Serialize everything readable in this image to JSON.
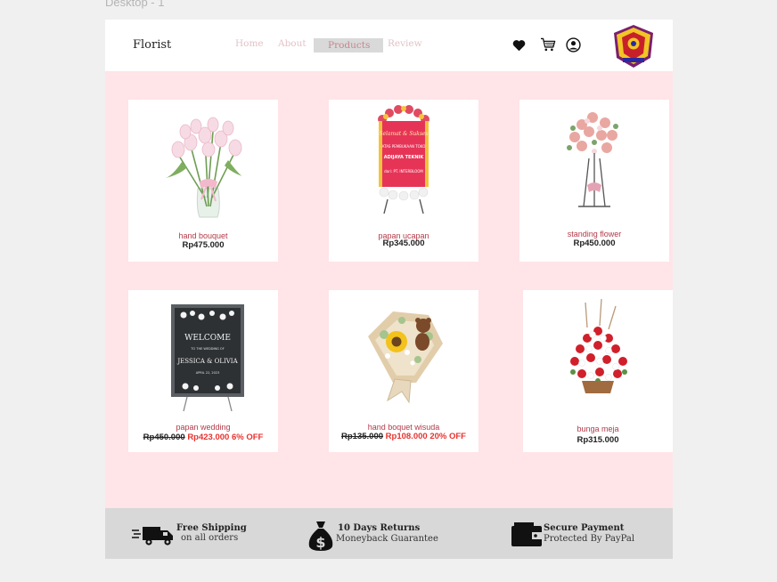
{
  "canvas": {
    "frame_label": "Desktop - 1"
  },
  "header": {
    "brand": "Florist",
    "nav": [
      "Home",
      "About",
      "Products",
      "Review"
    ],
    "active_nav": "Products",
    "icons": [
      "heart-icon",
      "cart-icon",
      "user-icon"
    ]
  },
  "products": [
    {
      "name": "hand bouquet",
      "price": "Rp475.000"
    },
    {
      "name": "papan ucapan",
      "price": "Rp345.000",
      "sign_lines": [
        "Selamat & Sukses",
        "ATAS PEMBUKAAN TOKO",
        "ADIJAYA TEKNIK",
        "dari: PT. INTERBLOOM"
      ]
    },
    {
      "name": "standing flower",
      "price": "Rp450.000"
    },
    {
      "name": "papan wedding",
      "old_price": "Rp450.000",
      "new_price": "Rp423.000 6% OFF",
      "sign_lines": [
        "WELCOME",
        "TO THE WEDDING OF",
        "JESSICA & OLIVIA",
        "APRIL 22, 2023"
      ]
    },
    {
      "name": "hand boquet wisuda",
      "old_price": "Rp135.000",
      "new_price": "Rp108.000 20% OFF"
    },
    {
      "name": "bunga meja",
      "price": "Rp315.000"
    }
  ],
  "footer": {
    "features": [
      {
        "title": "Free Shipping",
        "subtitle": "on all orders",
        "icon": "truck-icon"
      },
      {
        "title": "10 Days Returns",
        "subtitle": "Moneyback Guarantee",
        "icon": "money-bag-icon"
      },
      {
        "title": "Secure Payment",
        "subtitle": "Protected By PayPal",
        "icon": "wallet-icon"
      }
    ]
  },
  "colors": {
    "page_bg": "#ffe4e8",
    "header_bg": "#ffffff",
    "product_name": "#b33a48",
    "sale_price": "#e8322f",
    "footer_bg": "#d8d8d8",
    "nav_active_bg": "#d9d9d9"
  }
}
